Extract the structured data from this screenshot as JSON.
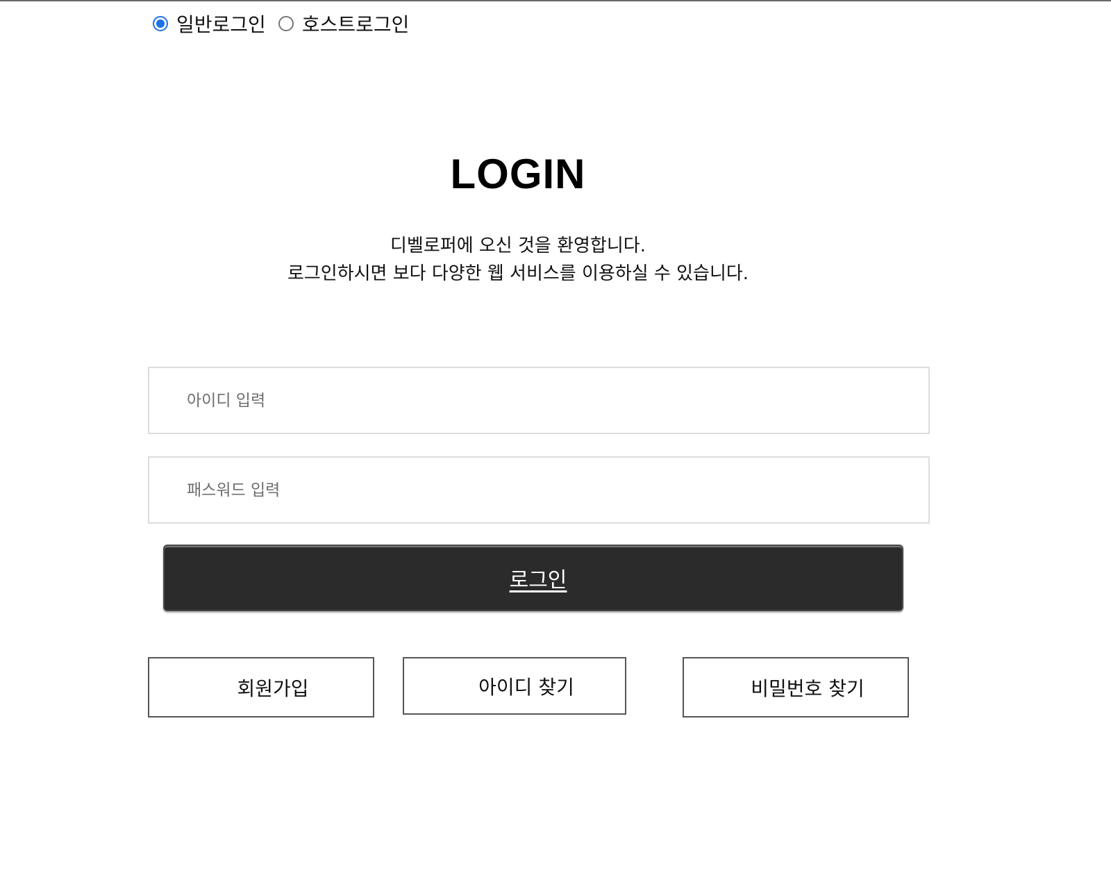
{
  "login_type": {
    "options": [
      {
        "label": "일반로그인",
        "selected": true
      },
      {
        "label": "호스트로그인",
        "selected": false
      }
    ]
  },
  "heading": "LOGIN",
  "welcome": {
    "line1": "디벨로퍼에 오신 것을 환영합니다.",
    "line2": "로그인하시면 보다 다양한 웹 서비스를 이용하실 수 있습니다."
  },
  "form": {
    "id_placeholder": "아이디 입력",
    "id_value": "",
    "password_placeholder": "패스워드 입력",
    "password_value": "",
    "login_label": "로그인"
  },
  "links": {
    "signup": "회원가입",
    "find_id": "아이디 찾기",
    "find_password": "비밀번호 찾기"
  },
  "colors": {
    "radio_accent": "#1a73e8",
    "login_button_bg": "#2b2b2b"
  }
}
